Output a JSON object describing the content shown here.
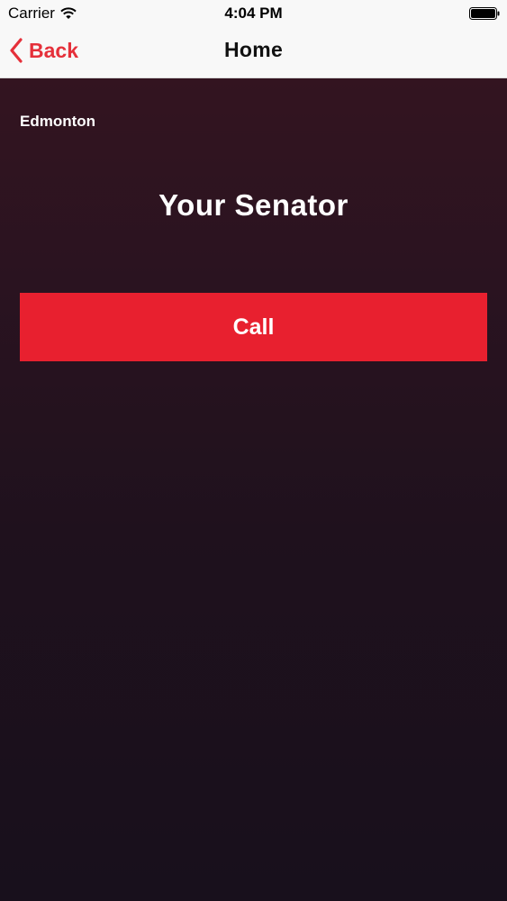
{
  "status_bar": {
    "carrier": "Carrier",
    "time": "4:04 PM"
  },
  "nav": {
    "back_label": "Back",
    "title": "Home"
  },
  "content": {
    "city": "Edmonton",
    "heading": "Your Senator",
    "call_label": "Call"
  },
  "colors": {
    "accent": "#e8202f",
    "back_tint": "#e5303a",
    "background_top": "#331420",
    "background_bottom": "#18101c"
  },
  "icons": {
    "wifi": "wifi-icon",
    "battery": "battery-icon",
    "back": "chevron-left-icon"
  }
}
